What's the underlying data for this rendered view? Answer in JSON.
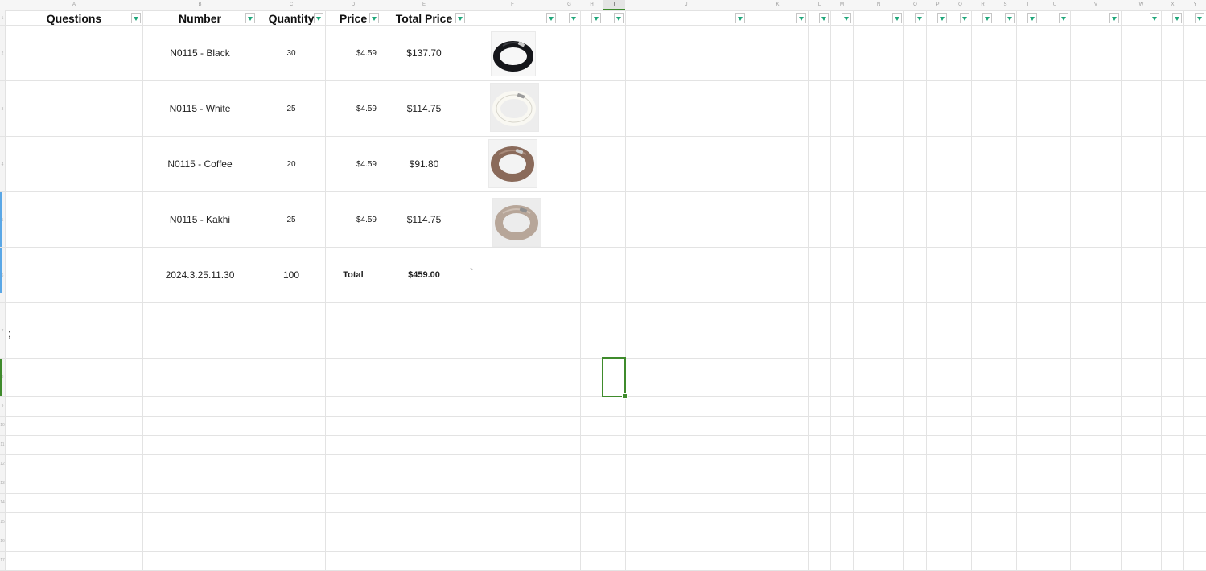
{
  "column_letters": [
    "A",
    "B",
    "C",
    "D",
    "E",
    "F",
    "G",
    "H",
    "I",
    "J",
    "K",
    "L",
    "M",
    "N",
    "O",
    "P",
    "Q",
    "R",
    "S",
    "T",
    "U",
    "V",
    "W",
    "X",
    "Y"
  ],
  "headers": {
    "questions": "Questions",
    "number": "Number",
    "quantity": "Quantity",
    "price": "Price",
    "total_price": "Total Price"
  },
  "rows": [
    {
      "number": "N0115 - Black",
      "quantity": "30",
      "price": "$4.59",
      "total": "$137.70",
      "image": "black headband"
    },
    {
      "number": "N0115 - White",
      "quantity": "25",
      "price": "$4.59",
      "total": "$114.75",
      "image": "white headband"
    },
    {
      "number": "N0115 - Coffee",
      "quantity": "20",
      "price": "$4.59",
      "total": "$91.80",
      "image": "coffee headband"
    },
    {
      "number": "N0115 - Kakhi",
      "quantity": "25",
      "price": "$4.59",
      "total": "$114.75",
      "image": "kakhi headband"
    }
  ],
  "summary": {
    "date": "2024.3.25.11.30",
    "quantity": "100",
    "label": "Total",
    "total": "$459.00",
    "stray_mark": "`"
  },
  "stray_a_cell": ";",
  "row_numbers": [
    "1",
    "2",
    "3",
    "4",
    "5",
    "6",
    "7",
    "8",
    "9",
    "10",
    "11",
    "12",
    "13",
    "14",
    "15",
    "16",
    "17"
  ],
  "selected_column": "I",
  "colors": {
    "selection": "#3f8b2c",
    "filter_arrow": "#1fa67a",
    "row_marker_blue": "#5aa7e6",
    "black_band": "#15161a",
    "white_band": "#efeee8",
    "coffee_band": "#8a6a5a",
    "kakhi_band": "#b7a699"
  },
  "icons": {
    "filter": "filter-dropdown-icon"
  }
}
